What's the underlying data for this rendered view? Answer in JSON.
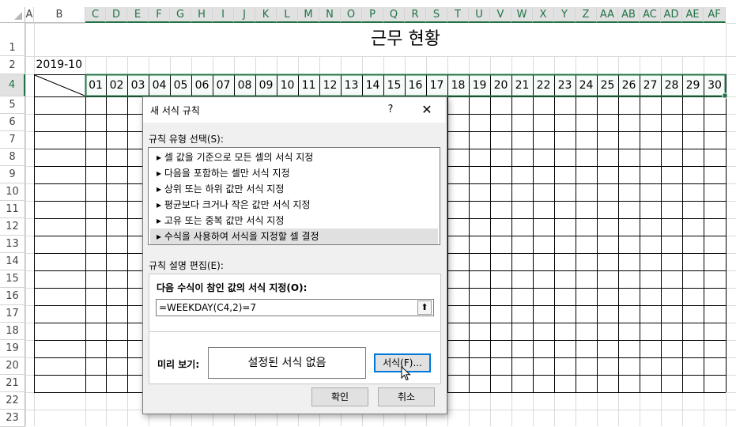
{
  "sheet": {
    "columns": [
      "A",
      "B",
      "C",
      "D",
      "E",
      "F",
      "G",
      "H",
      "I",
      "J",
      "K",
      "L",
      "M",
      "N",
      "O",
      "P",
      "Q",
      "R",
      "S",
      "T",
      "U",
      "V",
      "W",
      "X",
      "Y",
      "Z",
      "AA",
      "AB",
      "AC",
      "AD",
      "AE",
      "AF"
    ],
    "rows": [
      "1",
      "2",
      "4",
      "5",
      "6",
      "7",
      "8",
      "9",
      "10",
      "11",
      "12",
      "13",
      "14",
      "15",
      "16",
      "17",
      "18",
      "19",
      "20",
      "21",
      "22",
      "23"
    ],
    "title": "근무 현황",
    "date_cell": "2019-10",
    "days": [
      "01",
      "02",
      "03",
      "04",
      "05",
      "06",
      "07",
      "08",
      "09",
      "10",
      "11",
      "12",
      "13",
      "14",
      "15",
      "16",
      "17",
      "18",
      "19",
      "20",
      "21",
      "22",
      "23",
      "24",
      "25",
      "26",
      "27",
      "28",
      "29",
      "30"
    ]
  },
  "dialog": {
    "title": "새 서식 규칙",
    "help": "?",
    "close": "✕",
    "rule_type_label": "규칙 유형 선택(S):",
    "rule_types": [
      "▸ 셀 값을 기준으로 모든 셀의 서식 지정",
      "▸ 다음을 포함하는 셀만 서식 지정",
      "▸ 상위 또는 하위 값만 서식 지정",
      "▸ 평균보다 크거나 작은 값만 서식 지정",
      "▸ 고유 또는 중복 값만 서식 지정",
      "▸ 수식을 사용하여 서식을 지정할 셀 결정"
    ],
    "edit_label": "규칙 설명 편집(E):",
    "formula_label": "다음 수식이 참인 값의 서식 지정(O):",
    "formula_value": "=WEEKDAY(C4,2)=7",
    "collapse_icon": "⬆",
    "preview_label": "미리 보기:",
    "preview_text": "설정된 서식 없음",
    "format_button": "서식(F)...",
    "ok_button": "확인",
    "cancel_button": "취소"
  },
  "colors": {
    "accent": "#217346",
    "focus": "#0078d7"
  }
}
